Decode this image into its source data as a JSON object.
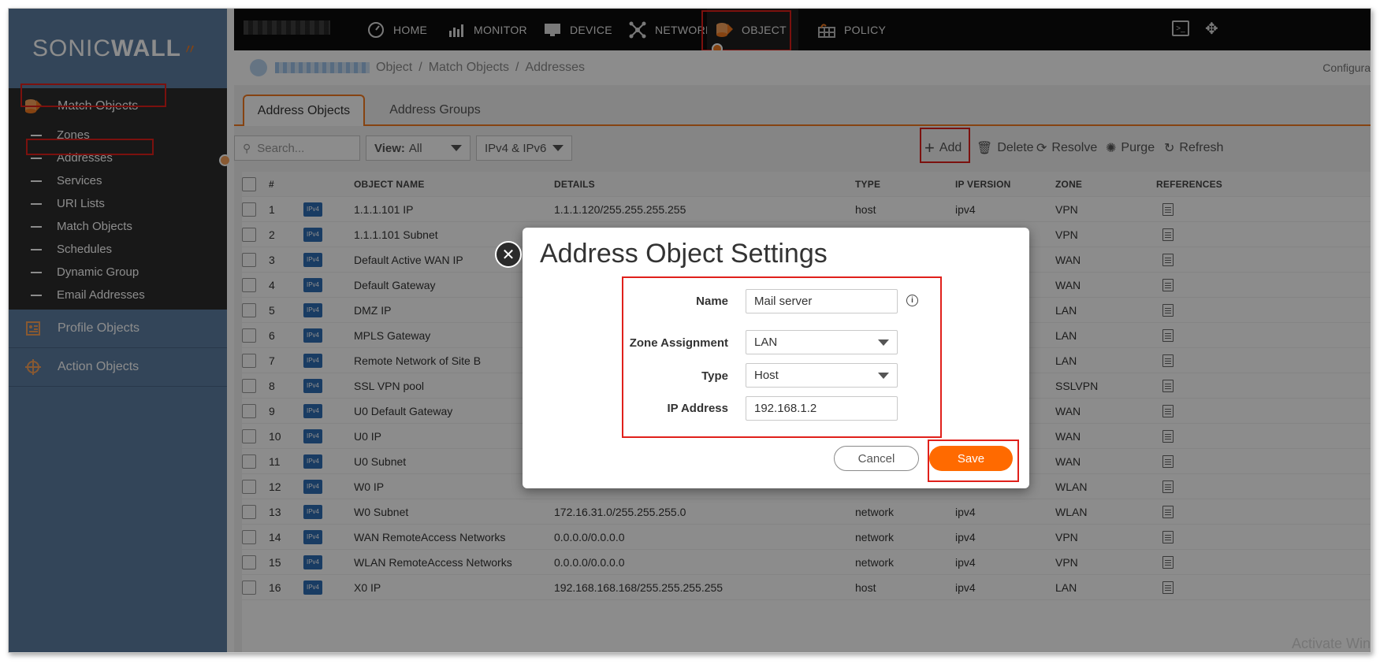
{
  "brand": {
    "logo_text_a": "SONIC",
    "logo_text_b": "WALL"
  },
  "sidebar": {
    "match_objects_label": "Match Objects",
    "items": [
      {
        "label": "Zones"
      },
      {
        "label": "Addresses"
      },
      {
        "label": "Services"
      },
      {
        "label": "URI Lists"
      },
      {
        "label": "Match Objects"
      },
      {
        "label": "Schedules"
      },
      {
        "label": "Dynamic Group"
      },
      {
        "label": "Email Addresses"
      }
    ],
    "profile_objects_label": "Profile Objects",
    "action_objects_label": "Action Objects"
  },
  "topnav": {
    "items": [
      {
        "label": "HOME",
        "icon": "gauge-icon"
      },
      {
        "label": "MONITOR",
        "icon": "chart-icon"
      },
      {
        "label": "DEVICE",
        "icon": "monitor-icon"
      },
      {
        "label": "NETWORK",
        "icon": "network-icon"
      },
      {
        "label": "OBJECT",
        "icon": "object-icon"
      },
      {
        "label": "POLICY",
        "icon": "policy-icon"
      }
    ]
  },
  "breadcrumb": {
    "part1": "Object",
    "sep": "/",
    "part2": "Match Objects",
    "part3": "Addresses",
    "right_text": "Configura"
  },
  "tabs": {
    "address_objects": "Address Objects",
    "address_groups": "Address Groups"
  },
  "toolbar": {
    "search_placeholder": "Search...",
    "view_label": "View:",
    "view_value": "All",
    "ip_filter": "IPv4 & IPv6",
    "add": "Add",
    "delete": "Delete",
    "resolve": "Resolve",
    "purge": "Purge",
    "refresh": "Refresh"
  },
  "table": {
    "headers": {
      "num": "#",
      "name": "OBJECT NAME",
      "details": "DETAILS",
      "type": "TYPE",
      "ipver": "IP VERSION",
      "zone": "ZONE",
      "refs": "REFERENCES"
    },
    "badge_text": "IPv4",
    "rows": [
      {
        "num": "1",
        "name": "1.1.1.101 IP",
        "details": "1.1.1.120/255.255.255.255",
        "type": "host",
        "ipver": "ipv4",
        "zone": "VPN"
      },
      {
        "num": "2",
        "name": "1.1.1.101 Subnet",
        "details": "",
        "type": "",
        "ipver": "",
        "zone": "VPN"
      },
      {
        "num": "3",
        "name": "Default Active WAN IP",
        "details": "",
        "type": "",
        "ipver": "",
        "zone": "WAN"
      },
      {
        "num": "4",
        "name": "Default Gateway",
        "details": "",
        "type": "",
        "ipver": "",
        "zone": "WAN"
      },
      {
        "num": "5",
        "name": "DMZ IP",
        "details": "",
        "type": "",
        "ipver": "",
        "zone": "LAN"
      },
      {
        "num": "6",
        "name": "MPLS Gateway",
        "details": "",
        "type": "",
        "ipver": "",
        "zone": "LAN"
      },
      {
        "num": "7",
        "name": "Remote Network of Site B",
        "details": "",
        "type": "",
        "ipver": "",
        "zone": "LAN"
      },
      {
        "num": "8",
        "name": "SSL VPN pool",
        "details": "",
        "type": "",
        "ipver": "",
        "zone": "SSLVPN"
      },
      {
        "num": "9",
        "name": "U0 Default Gateway",
        "details": "",
        "type": "",
        "ipver": "",
        "zone": "WAN"
      },
      {
        "num": "10",
        "name": "U0 IP",
        "details": "",
        "type": "",
        "ipver": "",
        "zone": "WAN"
      },
      {
        "num": "11",
        "name": "U0 Subnet",
        "details": "",
        "type": "",
        "ipver": "",
        "zone": "WAN"
      },
      {
        "num": "12",
        "name": "W0 IP",
        "details": "",
        "type": "",
        "ipver": "",
        "zone": "WLAN"
      },
      {
        "num": "13",
        "name": "W0 Subnet",
        "details": "172.16.31.0/255.255.255.0",
        "type": "network",
        "ipver": "ipv4",
        "zone": "WLAN"
      },
      {
        "num": "14",
        "name": "WAN RemoteAccess Networks",
        "details": "0.0.0.0/0.0.0.0",
        "type": "network",
        "ipver": "ipv4",
        "zone": "VPN"
      },
      {
        "num": "15",
        "name": "WLAN RemoteAccess Networks",
        "details": "0.0.0.0/0.0.0.0",
        "type": "network",
        "ipver": "ipv4",
        "zone": "VPN"
      },
      {
        "num": "16",
        "name": "X0 IP",
        "details": "192.168.168.168/255.255.255.255",
        "type": "host",
        "ipver": "ipv4",
        "zone": "LAN"
      }
    ]
  },
  "modal": {
    "title": "Address Object Settings",
    "name_label": "Name",
    "name_value": "Mail server",
    "zone_label": "Zone Assignment",
    "zone_value": "LAN",
    "type_label": "Type",
    "type_value": "Host",
    "ip_label": "IP Address",
    "ip_value": "192.168.1.2",
    "info_glyph": "i",
    "close_glyph": "✕",
    "cancel": "Cancel",
    "save": "Save"
  },
  "watermark": "Activate Windo",
  "colors": {
    "accent": "#f47b20",
    "sidebar": "#5e7fa3",
    "save": "#ff6a00",
    "highlight": "#e0201b"
  }
}
